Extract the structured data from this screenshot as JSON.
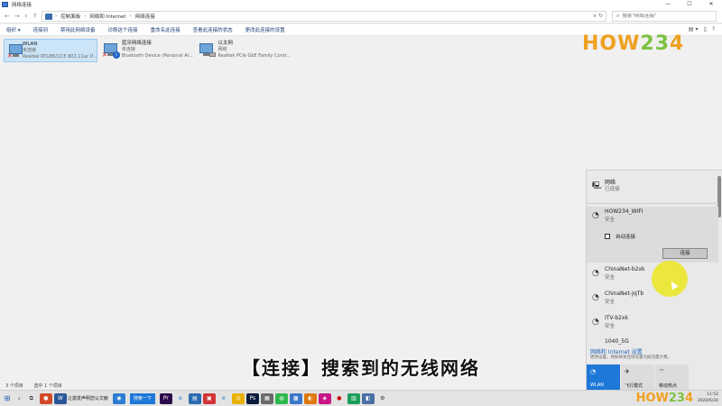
{
  "window": {
    "title": "网络连接",
    "controls": [
      "—",
      "☐",
      "✕"
    ]
  },
  "address": {
    "crumbs": [
      "控制面板",
      "网络和 Internet",
      "网络连接"
    ],
    "search_placeholder": "搜索\"网络连接\""
  },
  "toolbar": {
    "items": [
      "组织 ▾",
      "连接到",
      "禁用此网络设备",
      "诊断这个连接",
      "重命名此连接",
      "查看此连接的状态",
      "更改此连接的设置"
    ]
  },
  "adapters": [
    {
      "name": "WLAN",
      "status": "未连接",
      "device": "Realtek RTL8821CE 802.11ac P...",
      "badge": "x"
    },
    {
      "name": "蓝牙网络连接",
      "status": "未连接",
      "device": "Bluetooth Device (Personal Ar...",
      "badge": "bt"
    },
    {
      "name": "以太网",
      "status": "网络",
      "device": "Realtek PCIe GbE Family Contr...",
      "badge": "cable"
    }
  ],
  "logo": {
    "part1": "HOW",
    "part2": "23",
    "part3": "4"
  },
  "statusbar": {
    "count": "3 个项目",
    "selected": "选中 1 个项目"
  },
  "flyout": {
    "header": {
      "name": "网络",
      "status": "已连接"
    },
    "networks": [
      {
        "name": "HOW234_WIFI",
        "status": "安全"
      },
      {
        "name": "ChinaNet-b2xk",
        "status": "安全"
      },
      {
        "name": "ChinaNet-JqTb",
        "status": "安全"
      },
      {
        "name": "ITV-b2xk",
        "status": "安全"
      },
      {
        "name": "1040_5G",
        "status": ""
      }
    ],
    "auto_connect_label": "自动连接",
    "connect_button": "连接",
    "settings_link": "网络和 Internet 设置",
    "settings_sub": "更改设置，例如将某连接设置为按流量计费。",
    "quick_actions": [
      {
        "icon": "wifi-icon",
        "label": "WLAN"
      },
      {
        "icon": "airplane-icon",
        "label": "飞行模式"
      },
      {
        "icon": "hotspot-icon",
        "label": "移动热点"
      }
    ]
  },
  "subtitle": "【连接】搜索到的无线网络",
  "taskbar": {
    "search_text": "",
    "doc_label": "让激发声明您认文献",
    "button_label": "搜索一下",
    "tray_time": "11:52",
    "tray_date": "2020/6/30"
  }
}
